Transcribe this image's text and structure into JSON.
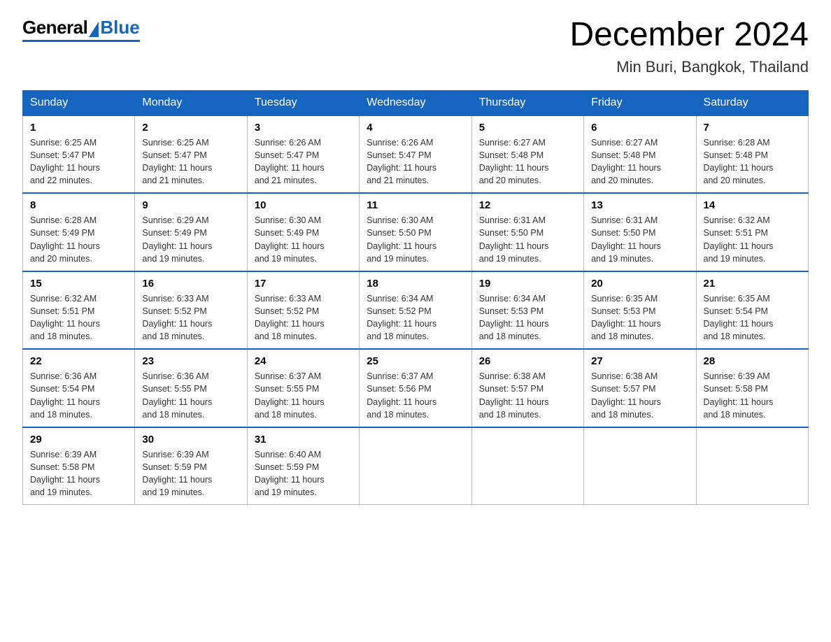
{
  "logo": {
    "general": "General",
    "blue": "Blue"
  },
  "title": "December 2024",
  "subtitle": "Min Buri, Bangkok, Thailand",
  "weekdays": [
    "Sunday",
    "Monday",
    "Tuesday",
    "Wednesday",
    "Thursday",
    "Friday",
    "Saturday"
  ],
  "weeks": [
    [
      {
        "day": "1",
        "sunrise": "6:25 AM",
        "sunset": "5:47 PM",
        "daylight": "11 hours and 22 minutes."
      },
      {
        "day": "2",
        "sunrise": "6:25 AM",
        "sunset": "5:47 PM",
        "daylight": "11 hours and 21 minutes."
      },
      {
        "day": "3",
        "sunrise": "6:26 AM",
        "sunset": "5:47 PM",
        "daylight": "11 hours and 21 minutes."
      },
      {
        "day": "4",
        "sunrise": "6:26 AM",
        "sunset": "5:47 PM",
        "daylight": "11 hours and 21 minutes."
      },
      {
        "day": "5",
        "sunrise": "6:27 AM",
        "sunset": "5:48 PM",
        "daylight": "11 hours and 20 minutes."
      },
      {
        "day": "6",
        "sunrise": "6:27 AM",
        "sunset": "5:48 PM",
        "daylight": "11 hours and 20 minutes."
      },
      {
        "day": "7",
        "sunrise": "6:28 AM",
        "sunset": "5:48 PM",
        "daylight": "11 hours and 20 minutes."
      }
    ],
    [
      {
        "day": "8",
        "sunrise": "6:28 AM",
        "sunset": "5:49 PM",
        "daylight": "11 hours and 20 minutes."
      },
      {
        "day": "9",
        "sunrise": "6:29 AM",
        "sunset": "5:49 PM",
        "daylight": "11 hours and 19 minutes."
      },
      {
        "day": "10",
        "sunrise": "6:30 AM",
        "sunset": "5:49 PM",
        "daylight": "11 hours and 19 minutes."
      },
      {
        "day": "11",
        "sunrise": "6:30 AM",
        "sunset": "5:50 PM",
        "daylight": "11 hours and 19 minutes."
      },
      {
        "day": "12",
        "sunrise": "6:31 AM",
        "sunset": "5:50 PM",
        "daylight": "11 hours and 19 minutes."
      },
      {
        "day": "13",
        "sunrise": "6:31 AM",
        "sunset": "5:50 PM",
        "daylight": "11 hours and 19 minutes."
      },
      {
        "day": "14",
        "sunrise": "6:32 AM",
        "sunset": "5:51 PM",
        "daylight": "11 hours and 19 minutes."
      }
    ],
    [
      {
        "day": "15",
        "sunrise": "6:32 AM",
        "sunset": "5:51 PM",
        "daylight": "11 hours and 18 minutes."
      },
      {
        "day": "16",
        "sunrise": "6:33 AM",
        "sunset": "5:52 PM",
        "daylight": "11 hours and 18 minutes."
      },
      {
        "day": "17",
        "sunrise": "6:33 AM",
        "sunset": "5:52 PM",
        "daylight": "11 hours and 18 minutes."
      },
      {
        "day": "18",
        "sunrise": "6:34 AM",
        "sunset": "5:52 PM",
        "daylight": "11 hours and 18 minutes."
      },
      {
        "day": "19",
        "sunrise": "6:34 AM",
        "sunset": "5:53 PM",
        "daylight": "11 hours and 18 minutes."
      },
      {
        "day": "20",
        "sunrise": "6:35 AM",
        "sunset": "5:53 PM",
        "daylight": "11 hours and 18 minutes."
      },
      {
        "day": "21",
        "sunrise": "6:35 AM",
        "sunset": "5:54 PM",
        "daylight": "11 hours and 18 minutes."
      }
    ],
    [
      {
        "day": "22",
        "sunrise": "6:36 AM",
        "sunset": "5:54 PM",
        "daylight": "11 hours and 18 minutes."
      },
      {
        "day": "23",
        "sunrise": "6:36 AM",
        "sunset": "5:55 PM",
        "daylight": "11 hours and 18 minutes."
      },
      {
        "day": "24",
        "sunrise": "6:37 AM",
        "sunset": "5:55 PM",
        "daylight": "11 hours and 18 minutes."
      },
      {
        "day": "25",
        "sunrise": "6:37 AM",
        "sunset": "5:56 PM",
        "daylight": "11 hours and 18 minutes."
      },
      {
        "day": "26",
        "sunrise": "6:38 AM",
        "sunset": "5:57 PM",
        "daylight": "11 hours and 18 minutes."
      },
      {
        "day": "27",
        "sunrise": "6:38 AM",
        "sunset": "5:57 PM",
        "daylight": "11 hours and 18 minutes."
      },
      {
        "day": "28",
        "sunrise": "6:39 AM",
        "sunset": "5:58 PM",
        "daylight": "11 hours and 18 minutes."
      }
    ],
    [
      {
        "day": "29",
        "sunrise": "6:39 AM",
        "sunset": "5:58 PM",
        "daylight": "11 hours and 19 minutes."
      },
      {
        "day": "30",
        "sunrise": "6:39 AM",
        "sunset": "5:59 PM",
        "daylight": "11 hours and 19 minutes."
      },
      {
        "day": "31",
        "sunrise": "6:40 AM",
        "sunset": "5:59 PM",
        "daylight": "11 hours and 19 minutes."
      },
      null,
      null,
      null,
      null
    ]
  ],
  "labels": {
    "sunrise": "Sunrise:",
    "sunset": "Sunset:",
    "daylight": "Daylight:"
  }
}
